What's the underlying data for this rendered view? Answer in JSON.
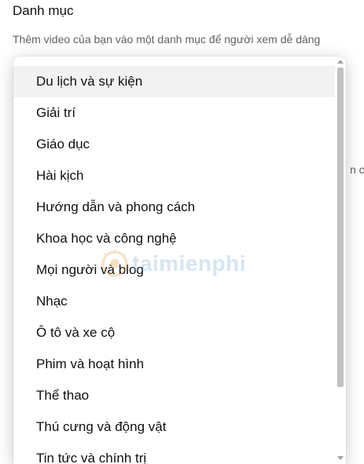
{
  "section": {
    "title": "Danh mục",
    "description": "Thêm video của bạn vào một danh mục để người xem dễ dàng",
    "bg_fragment": "n cá"
  },
  "dropdown": {
    "options": [
      {
        "label": "Du lịch và sự kiện",
        "selected": true
      },
      {
        "label": "Giải trí"
      },
      {
        "label": "Giáo dục"
      },
      {
        "label": "Hài kịch"
      },
      {
        "label": "Hướng dẫn và phong cách"
      },
      {
        "label": "Khoa học và công nghệ"
      },
      {
        "label": "Mọi người và blog"
      },
      {
        "label": "Nhạc"
      },
      {
        "label": "Ô tô và xe cộ"
      },
      {
        "label": "Phim và hoạt hình"
      },
      {
        "label": "Thể thao"
      },
      {
        "label": "Thú cưng và động vật"
      },
      {
        "label": "Tin tức và chính trị"
      }
    ]
  },
  "watermark": {
    "text": "taimienphi",
    "logo_icon": "watermark-logo-icon"
  },
  "colors": {
    "selected_bg": "#f2f2f2",
    "text": "#0f0f0f",
    "muted_text": "#606060",
    "scrollbar_thumb": "#c1c1c1"
  }
}
